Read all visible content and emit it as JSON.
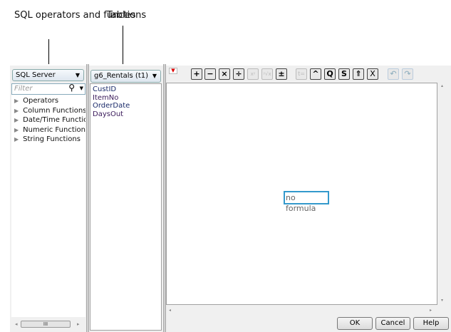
{
  "callouts": {
    "operators": "SQL operators and functions",
    "tables": "Tables"
  },
  "left": {
    "dialect": "SQL Server",
    "filter_placeholder": "Filter",
    "items": [
      "Operators",
      "Column Functions",
      "Date/Time Functions",
      "Numeric Functions",
      "String Functions"
    ],
    "scroll_thumb": "III"
  },
  "tables": {
    "selected": "g6_Rentals (t1)",
    "columns": [
      "CustID",
      "ItemNo",
      "OrderDate",
      "DaysOut"
    ]
  },
  "editor": {
    "placeholder": "no formula"
  },
  "toolbar": {
    "plus": "+",
    "minus": "−",
    "times": "×",
    "divide": "÷",
    "power": "xʸ",
    "root": "ʸ√x",
    "plusminus": "±",
    "text": "t=",
    "caret": "^",
    "q": "Q",
    "s": "S",
    "up": "⇑",
    "x": "X",
    "undo": "↶",
    "redo": "↷"
  },
  "buttons": {
    "ok": "OK",
    "cancel": "Cancel",
    "help": "Help"
  }
}
